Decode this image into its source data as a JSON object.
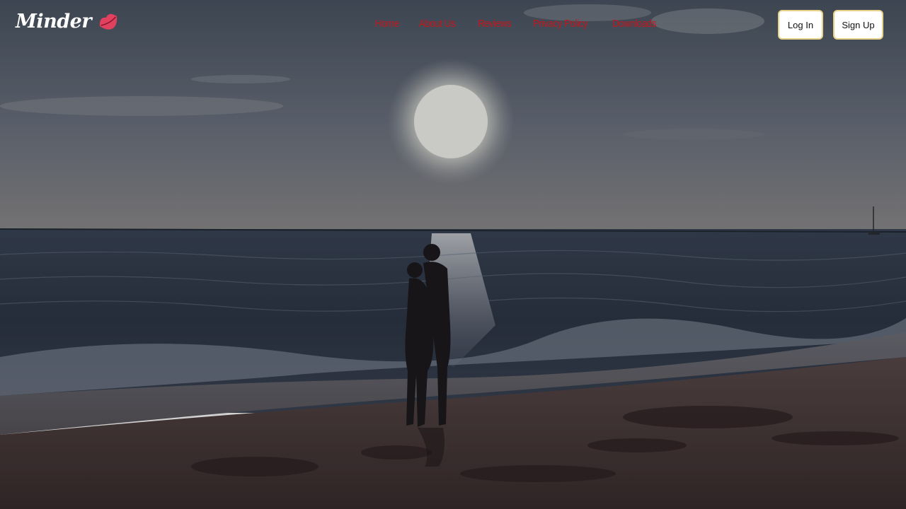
{
  "brand": {
    "name": "Minder",
    "accent": "#e0415f"
  },
  "nav": {
    "items": [
      {
        "label": "Home"
      },
      {
        "label": "About Us"
      },
      {
        "label": "Reviews"
      },
      {
        "label": "Privacy Policy"
      },
      {
        "label": "Downloads"
      }
    ],
    "color": "#c4161c"
  },
  "auth": {
    "login_label": "Log In",
    "signup_label": "Sign Up"
  },
  "hero": {
    "image": "beach-sunset-couple-silhouette"
  }
}
